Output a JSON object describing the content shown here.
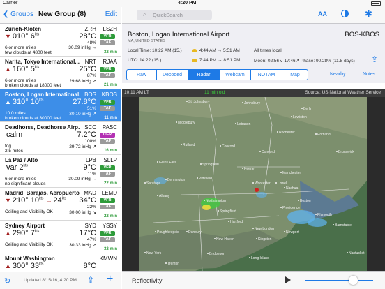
{
  "status": {
    "carrier": "Carrier",
    "time": "4:20 PM"
  },
  "nav": {
    "back_label": "Groups",
    "title": "New Group (8)",
    "edit_label": "Edit"
  },
  "stations": [
    {
      "name": "Zurich-Kloten",
      "iata": "ZRH",
      "icao": "LSZH",
      "arrow": "▼",
      "wind_dir": "010°",
      "wind_speed": "6",
      "wind_unit": "kts",
      "temp": "28°C",
      "pct": "48%",
      "category": "VFR",
      "line3": "6 or more miles",
      "inhg": "30.09 inHg →",
      "line4": "few clouds at 4800 feet",
      "age": "32 min",
      "selected": false
    },
    {
      "name": "Narita, Tokyo International...",
      "iata": "NRT",
      "icao": "RJAA",
      "arrow": "▲",
      "wind_dir": "160°",
      "wind_speed": "5",
      "wind_unit": "kts",
      "temp": "25°C",
      "pct": "87%",
      "category": "VFR",
      "line3": "6 or more miles",
      "inhg": "29.68 inHg ↗",
      "line4": "broken clouds at 18000 feet",
      "age": "21 min",
      "selected": false
    },
    {
      "name": "Boston, Logan International...",
      "iata": "BOS",
      "icao": "KBOS",
      "arrow": "▲",
      "wind_dir": "310°",
      "wind_speed": "10",
      "wind_unit": "kts",
      "temp": "27.8°C",
      "pct": "51%",
      "category": "VFR",
      "line3": "10.0 miles",
      "inhg": "30.10 inHg ↗",
      "line4": "broken clouds at 30000 feet",
      "age": "11 min",
      "selected": true
    },
    {
      "name": "Deadhorse, Deadhorse Airp...",
      "iata": "SCC",
      "icao": "PASC",
      "arrow": "",
      "wind_dir": "calm",
      "wind_speed": "",
      "wind_unit": "",
      "temp": "7.2°C",
      "pct": "100%",
      "category": "LIFR",
      "line3": "fog",
      "inhg": "29.72 inHg ↗",
      "line4": "2.5 miles",
      "age": "16 min",
      "selected": false
    },
    {
      "name": "La Paz / Alto",
      "iata": "LPB",
      "icao": "SLLP",
      "arrow": "",
      "wind_dir": "var",
      "wind_speed": "2",
      "wind_unit": "kts",
      "temp": "9°C",
      "pct": "11%",
      "category": "VFR",
      "line3": "6 or more miles",
      "inhg": "30.09 inHg →",
      "line4": "no significant clouds",
      "age": "22 min",
      "selected": false
    },
    {
      "name": "Madrid–Barajas, Aeropuerto...",
      "iata": "MAD",
      "icao": "LEMD",
      "arrow": "▼",
      "wind_dir": "210°",
      "wind_speed": "10",
      "wind_unit": "kts",
      "gust": "24",
      "temp": "34°C",
      "pct": "22%",
      "category": "VFR",
      "line3": "Ceiling and Visibility OK",
      "inhg": "30.00 inHg ↘",
      "line4": "",
      "age": "22 min",
      "selected": false
    },
    {
      "name": "Sydney Airport",
      "iata": "SYD",
      "icao": "YSSY",
      "arrow": "▲",
      "wind_dir": "290°",
      "wind_speed": "7",
      "wind_unit": "kts",
      "temp": "17°C",
      "pct": "47%",
      "category": "VFR",
      "line3": "Ceiling and Visibility OK",
      "inhg": "30.33 inHg ↗",
      "line4": "",
      "age": "32 min",
      "selected": false
    },
    {
      "name": "Mount Washington",
      "iata": "",
      "icao": "KMWN",
      "arrow": "▲",
      "wind_dir": "300°",
      "wind_speed": "33",
      "wind_unit": "kts",
      "temp": "8°C",
      "pct": "",
      "category": "",
      "line3": "",
      "inhg": "",
      "line4": "",
      "age": "",
      "selected": false
    }
  ],
  "bottom_left": {
    "updated": "Updated 8/15/16, 4:20 PM"
  },
  "search": {
    "placeholder": "QuickSearch"
  },
  "airport": {
    "name": "Boston, Logan International Airport",
    "code": "BOS-KBOS",
    "location": "MA, UNITED STATES",
    "local_time": "Local Time: 10:22 AM (15.)",
    "utc_time": "UTC: 14:22 (15.)",
    "sunrise": "4:44 AM → 5:51 AM",
    "sunset": "7:44 PM → 8:51 PM",
    "times_note": "All times local",
    "moon": "Moon: 02:56↘ 17:46↗ Phase: 90.28% (11.8 days)"
  },
  "tabs": [
    "Raw",
    "Decoded",
    "Radar",
    "Webcam",
    "NOTAM",
    "Map"
  ],
  "active_tab": "Radar",
  "links": {
    "nearby": "Nearby",
    "notes": "Notes"
  },
  "radar": {
    "local_time": "10:11 AM LT",
    "age": "11 min old",
    "source": "Source: US National Weather Service",
    "cities": [
      "St. Johnsbury",
      "Johnsbury",
      "Lewiston",
      "Portland",
      "Middlebury",
      "Rochester",
      "Berlin",
      "Brunswick",
      "Rutland",
      "Concord",
      "Lebanon",
      "Concord",
      "Glens Falls",
      "Springfield",
      "Keene",
      "Manchester",
      "Nashua",
      "Bennington",
      "Lowell",
      "Saratoga",
      "Albany",
      "Northampton",
      "Worcester",
      "Boston",
      "Pittsfield",
      "Springfield",
      "Providence",
      "Hartford",
      "New Haven",
      "Plymouth",
      "Barnstable",
      "Kingston",
      "Danbury",
      "New London",
      "Newport",
      "Nantucket",
      "Poughkeepsie",
      "Bridgeport",
      "Long Island",
      "Trenton",
      "New York"
    ]
  },
  "bottom_right": {
    "mode": "Reflectivity"
  },
  "colors": {
    "accent": "#1e7ae6",
    "selected_row": "#3d8ee8",
    "vfr": "#2e9b3a",
    "lifr": "#b331b3",
    "radar_green": "#3ad13a"
  }
}
